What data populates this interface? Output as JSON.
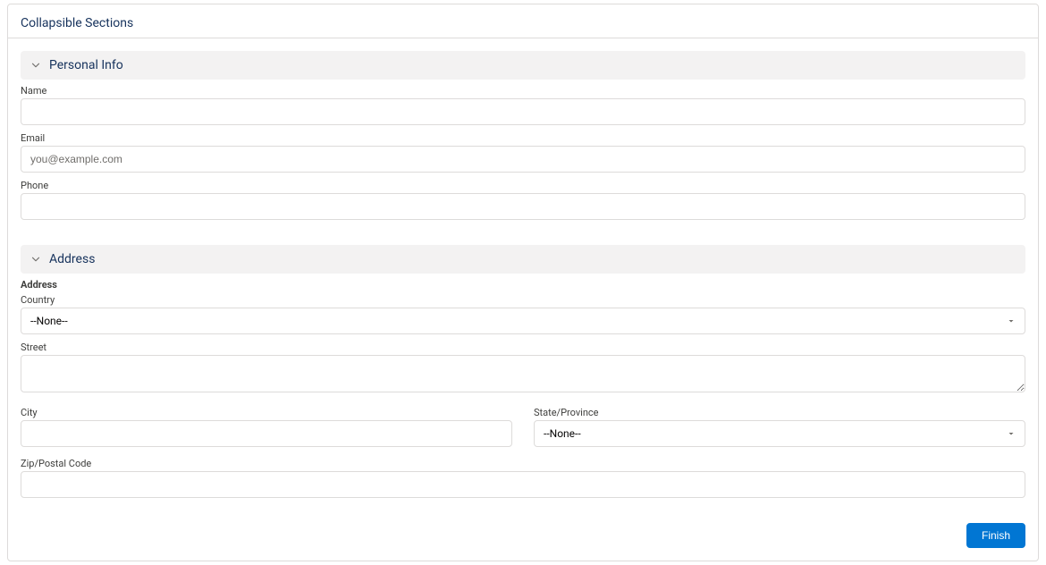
{
  "card": {
    "title": "Collapsible Sections"
  },
  "sections": {
    "personal": {
      "title": "Personal Info"
    },
    "address": {
      "title": "Address"
    }
  },
  "fields": {
    "name": {
      "label": "Name",
      "value": "",
      "placeholder": ""
    },
    "email": {
      "label": "Email",
      "value": "",
      "placeholder": "you@example.com"
    },
    "phone": {
      "label": "Phone",
      "value": "",
      "placeholder": ""
    },
    "address_group_label": "Address",
    "country": {
      "label": "Country",
      "selected": "--None--"
    },
    "street": {
      "label": "Street",
      "value": ""
    },
    "city": {
      "label": "City",
      "value": ""
    },
    "state": {
      "label": "State/Province",
      "selected": "--None--"
    },
    "zip": {
      "label": "Zip/Postal Code",
      "value": ""
    }
  },
  "actions": {
    "finish": "Finish"
  }
}
